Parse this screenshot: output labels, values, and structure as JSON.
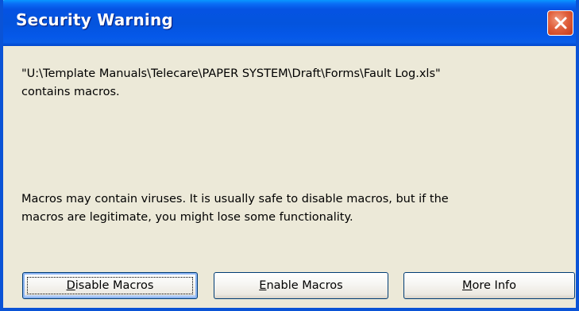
{
  "dialog": {
    "title": "Security Warning",
    "close_icon": "close-icon",
    "message_path_line1": "\"U:\\Template Manuals\\Telecare\\PAPER SYSTEM\\Draft\\Forms\\Fault Log.xls\"",
    "message_path_line2": "contains macros.",
    "warning_line1": "Macros may contain viruses. It is usually safe to disable macros, but if the",
    "warning_line2": "macros are legitimate, you might lose some functionality.",
    "buttons": {
      "disable": "Disable Macros",
      "enable": "Enable Macros",
      "more_info": "More Info"
    }
  },
  "colors": {
    "title_bar": "#0454dd",
    "window_border": "#0a53d6",
    "dialog_background": "#ece9d8",
    "close_button": "#e0603c"
  }
}
